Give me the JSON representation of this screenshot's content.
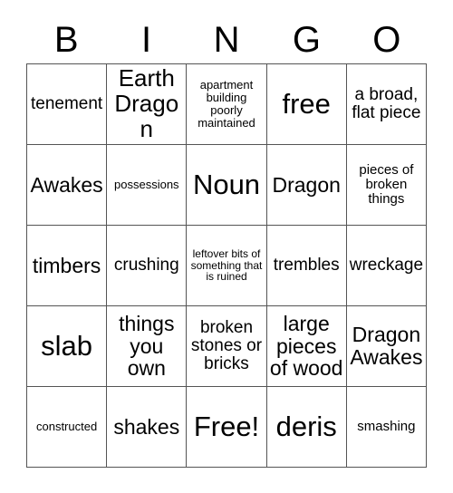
{
  "header": {
    "letters": [
      "B",
      "I",
      "N",
      "G",
      "O"
    ]
  },
  "grid": {
    "rows": [
      [
        {
          "text": "tenement",
          "size": "md"
        },
        {
          "text": "Earth Dragon",
          "size": "xl"
        },
        {
          "text": "apartment building poorly maintained",
          "size": "xs"
        },
        {
          "text": "free",
          "size": "xxl"
        },
        {
          "text": "a broad, flat piece",
          "size": "md"
        }
      ],
      [
        {
          "text": "Awakes",
          "size": "lg"
        },
        {
          "text": "possessions",
          "size": "xs"
        },
        {
          "text": "Noun",
          "size": "xxl"
        },
        {
          "text": "Dragon",
          "size": "lg"
        },
        {
          "text": "pieces of broken things",
          "size": "sm"
        }
      ],
      [
        {
          "text": "timbers",
          "size": "lg"
        },
        {
          "text": "crushing",
          "size": "md"
        },
        {
          "text": "leftover bits of something that is ruined",
          "size": "xxs"
        },
        {
          "text": "trembles",
          "size": "md"
        },
        {
          "text": "wreckage",
          "size": "md"
        }
      ],
      [
        {
          "text": "slab",
          "size": "xxl"
        },
        {
          "text": "things you own",
          "size": "lg"
        },
        {
          "text": "broken stones or bricks",
          "size": "md"
        },
        {
          "text": "large pieces of wood",
          "size": "lg"
        },
        {
          "text": "Dragon Awakes",
          "size": "lg"
        }
      ],
      [
        {
          "text": "constructed",
          "size": "xs"
        },
        {
          "text": "shakes",
          "size": "lg"
        },
        {
          "text": "Free!",
          "size": "xxl"
        },
        {
          "text": "deris",
          "size": "xxl"
        },
        {
          "text": "smashing",
          "size": "sm"
        }
      ]
    ]
  },
  "colors": {
    "background": "#ffffff",
    "text": "#000000",
    "grid_line": "#555555"
  }
}
